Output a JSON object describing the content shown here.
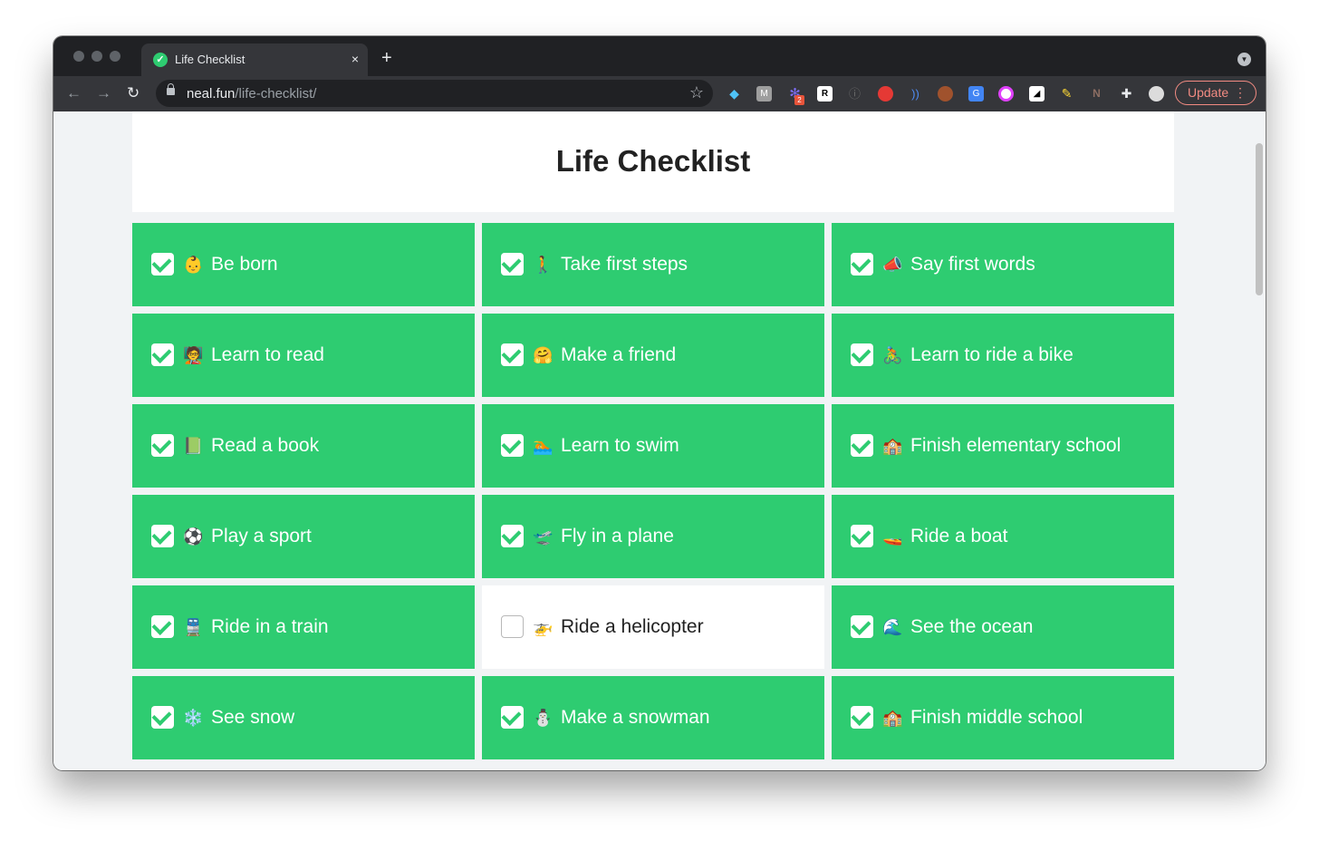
{
  "browser": {
    "tab_title": "Life Checklist",
    "tab_favicon": "✓",
    "tab_close": "×",
    "new_tab": "+",
    "url_host": "neal.fun",
    "url_path": "/life-checklist/",
    "update_label": "Update",
    "update_menu": "⋮",
    "back_icon": "←",
    "forward_icon": "→",
    "reload_icon": "↻",
    "bookmark_icon": "☆",
    "extension_badge": "2"
  },
  "page": {
    "title": "Life Checklist"
  },
  "items": [
    {
      "emoji": "👶",
      "label": "Be born",
      "checked": true
    },
    {
      "emoji": "🚶",
      "label": "Take first steps",
      "checked": true
    },
    {
      "emoji": "📣",
      "label": "Say first words",
      "checked": true
    },
    {
      "emoji": "🧑‍🏫",
      "label": "Learn to read",
      "checked": true
    },
    {
      "emoji": "🤗",
      "label": "Make a friend",
      "checked": true
    },
    {
      "emoji": "🚴",
      "label": "Learn to ride a bike",
      "checked": true
    },
    {
      "emoji": "📗",
      "label": "Read a book",
      "checked": true
    },
    {
      "emoji": "🏊",
      "label": "Learn to swim",
      "checked": true
    },
    {
      "emoji": "🏫",
      "label": "Finish elementary school",
      "checked": true
    },
    {
      "emoji": "⚽",
      "label": "Play a sport",
      "checked": true
    },
    {
      "emoji": "🛫",
      "label": "Fly in a plane",
      "checked": true
    },
    {
      "emoji": "🚤",
      "label": "Ride a boat",
      "checked": true
    },
    {
      "emoji": "🚆",
      "label": "Ride in a train",
      "checked": true
    },
    {
      "emoji": "🚁",
      "label": "Ride a helicopter",
      "checked": false
    },
    {
      "emoji": "🌊",
      "label": "See the ocean",
      "checked": true
    },
    {
      "emoji": "❄️",
      "label": "See snow",
      "checked": true
    },
    {
      "emoji": "⛄",
      "label": "Make a snowman",
      "checked": true
    },
    {
      "emoji": "🏫",
      "label": "Finish middle school",
      "checked": true
    }
  ],
  "colors": {
    "checked_bg": "#2ecc71",
    "unchecked_bg": "#ffffff",
    "page_bg": "#f1f3f5",
    "update_accent": "#f28b82"
  }
}
